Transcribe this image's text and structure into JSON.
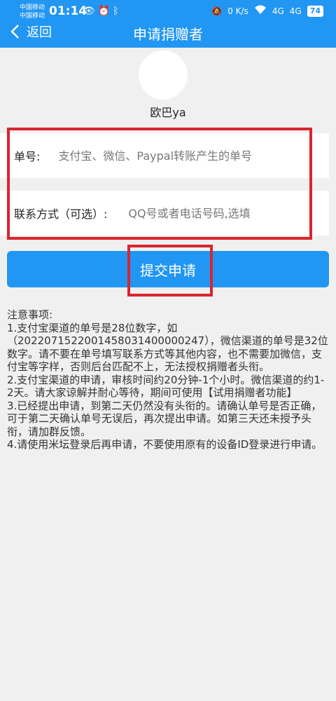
{
  "status_bar": {
    "carrier_1": "中国移动",
    "carrier_2": "中国移动",
    "time": "01:14",
    "speed": "0 K/s",
    "signal_1": "4G",
    "signal_2": "4G",
    "battery": "74"
  },
  "nav": {
    "back_label": "返回",
    "title": "申请捐赠者"
  },
  "profile": {
    "username": "欧巴ya"
  },
  "form": {
    "order_label": "单号:",
    "order_placeholder": "支付宝、微信、Paypal转账产生的单号",
    "contact_label": "联系方式（可选）:",
    "contact_placeholder": "QQ号或者电话号码,选填",
    "submit_label": "提交申请"
  },
  "notes": {
    "heading": "注意事项:",
    "items": [
      "1.支付宝渠道的单号是28位数字，如（2022071522001458031400000247），微信渠道的单号是32位数字。请不要在单号填写联系方式等其他内容，也不需要加微信，支付宝等字样，否则后台匹配不上，无法授权捐赠者头衔。",
      "2.支付宝渠道的申请，审核时间约20分钟-1个小时。微信渠道的约1-2天。请大家谅解并耐心等待，期间可使用【试用捐赠者功能】",
      "3.已经提出申请，到第二天仍然没有头衔的。请确认单号是否正确，可于第二天确认单号无误后，再次提出申请。如第三天还未授予头衔，请加群反馈。",
      "4.请使用米坛登录后再申请，不要使用原有的设备ID登录进行申请。"
    ]
  },
  "colors": {
    "accent": "#2196f3",
    "highlight": "#d9252f",
    "background": "#f0f0f0"
  }
}
